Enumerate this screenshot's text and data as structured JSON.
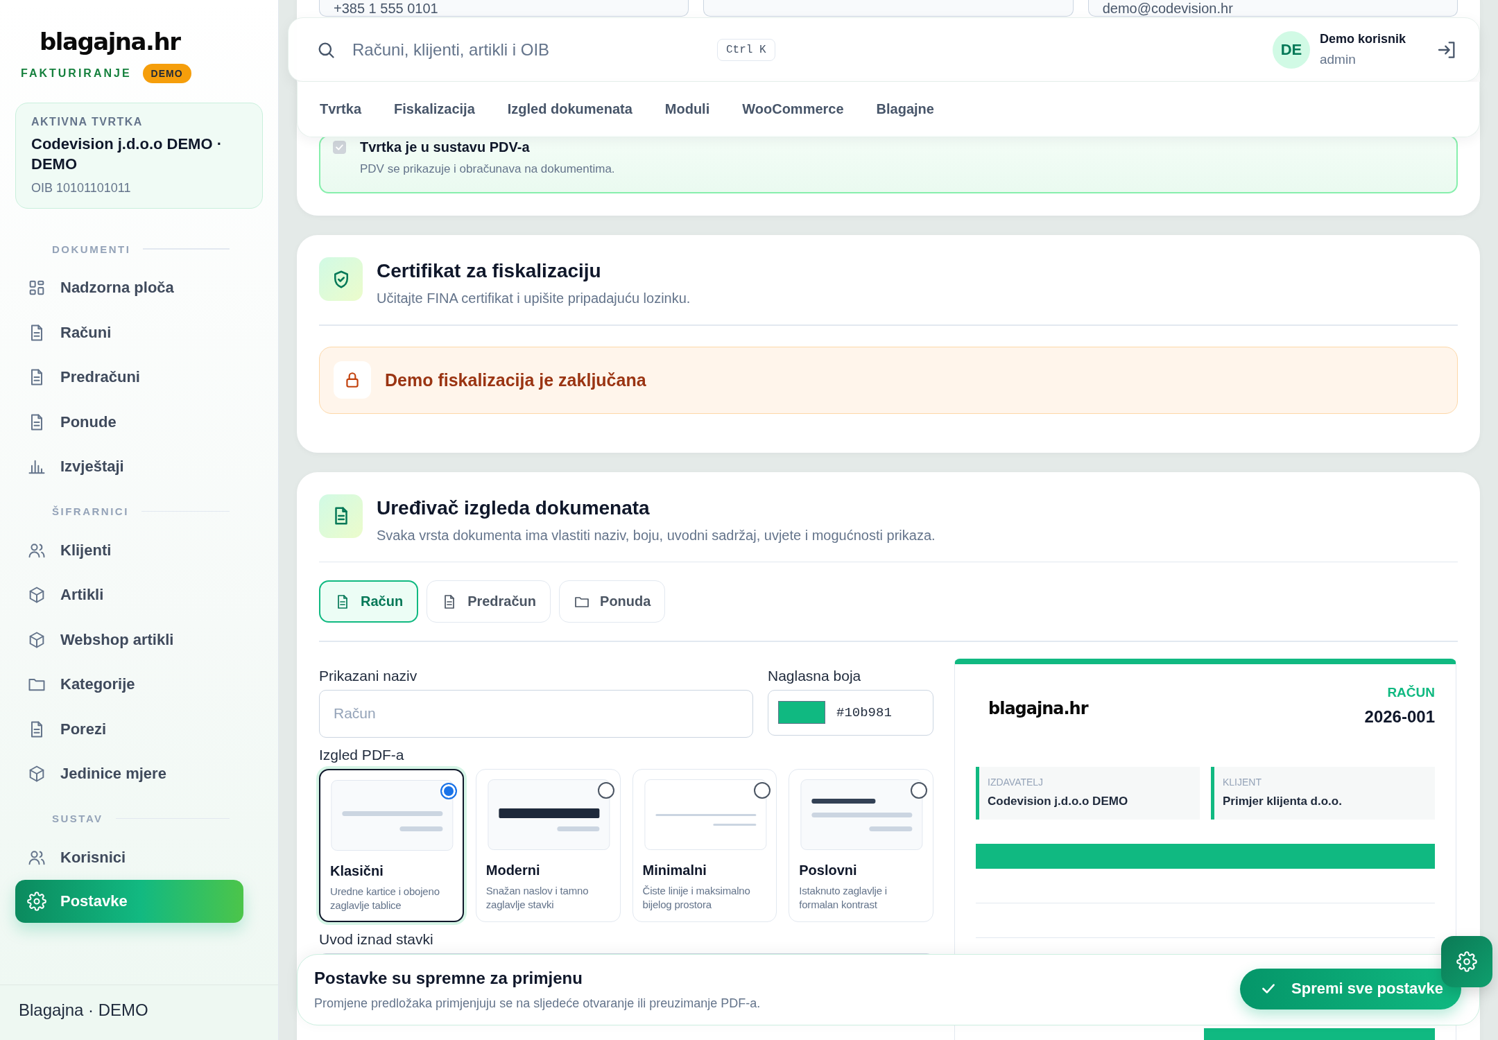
{
  "sidebar": {
    "logo": "blagajna.hr",
    "subtitle": "FAKTURIRANJE",
    "badge": "DEMO",
    "company": {
      "label": "AKTIVNA TVRTKA",
      "name": "Codevision j.d.o.o DEMO · DEMO",
      "oib": "OIB 10101101011"
    },
    "sections": [
      {
        "title": "DOKUMENTI",
        "items": [
          {
            "label": "Nadzorna ploča",
            "kind": "dashboard",
            "selected": false
          },
          {
            "label": "Računi",
            "kind": "document",
            "selected": false
          },
          {
            "label": "Predračuni",
            "kind": "document",
            "selected": false
          },
          {
            "label": "Ponude",
            "kind": "document",
            "selected": false
          },
          {
            "label": "Izvještaji",
            "kind": "report",
            "selected": false
          }
        ]
      },
      {
        "title": "ŠIFRARNICI",
        "items": [
          {
            "label": "Klijenti",
            "kind": "people",
            "selected": false
          },
          {
            "label": "Artikli",
            "kind": "product",
            "selected": false
          },
          {
            "label": "Webshop artikli",
            "kind": "product",
            "selected": false
          },
          {
            "label": "Kategorije",
            "kind": "folder",
            "selected": false
          },
          {
            "label": "Porezi",
            "kind": "document",
            "selected": false
          },
          {
            "label": "Jedinice mjere",
            "kind": "product",
            "selected": false
          }
        ]
      },
      {
        "title": "SUSTAV",
        "items": [
          {
            "label": "Korisnici",
            "kind": "people",
            "selected": false
          },
          {
            "label": "Postavke",
            "kind": "settings",
            "selected": true
          }
        ]
      }
    ],
    "footer": "Blagajna · DEMO"
  },
  "search": {
    "placeholder": "Računi, klijenti, artikli i OIB",
    "shortcut": "Ctrl K"
  },
  "user": {
    "initials": "DE",
    "name": "Demo korisnik",
    "role": "admin"
  },
  "settings_tabs": [
    {
      "label": "Tvrtka"
    },
    {
      "label": "Fiskalizacija"
    },
    {
      "label": "Izgled dokumenata"
    },
    {
      "label": "Moduli"
    },
    {
      "label": "WooCommerce"
    },
    {
      "label": "Blagajne"
    }
  ],
  "company_card": {
    "fields": [
      {
        "kind": "filled",
        "value": "+385 1 555 0101"
      },
      {
        "kind": "empty"
      },
      {
        "kind": "filled",
        "value": "demo@codevision.hr"
      }
    ],
    "vat": {
      "label": "Tvrtka je u sustavu PDV-a",
      "description": "PDV se prikazuje i obračunava na dokumentima.",
      "checked": true
    }
  },
  "certificate": {
    "title": "Certifikat za fiskalizaciju",
    "subtitle": "Učitajte FINA certifikat i upišite pripadajuću lozinku.",
    "alert": "Demo fiskalizacija je zaključana"
  },
  "editor": {
    "title": "Uređivač izgleda dokumenata",
    "subtitle": "Svaka vrsta dokumenta ima vlastiti naziv, boju, uvodni sadržaj, uvjete i mogućnosti prikaza.",
    "doc_tabs": [
      {
        "label": "Račun",
        "kind": "document",
        "selected": true
      },
      {
        "label": "Predračun",
        "kind": "document",
        "selected": false
      },
      {
        "label": "Ponuda",
        "kind": "folder",
        "selected": false
      }
    ],
    "name_field": {
      "label": "Prikazani naziv",
      "placeholder": "Račun"
    },
    "accent": {
      "label": "Naglasna boja",
      "value": "#10b981"
    },
    "templates_label": "Izgled PDF-a",
    "templates": [
      {
        "kind": "classic",
        "name": "Klasični",
        "description": "Uredne kartice i obojeno zaglavlje tablice",
        "selected": true
      },
      {
        "kind": "modern",
        "name": "Moderni",
        "description": "Snažan naslov i tamno zaglavlje stavki",
        "selected": false
      },
      {
        "kind": "minimal",
        "name": "Minimalni",
        "description": "Čiste linije i maksimalno bijelog prostora",
        "selected": false
      },
      {
        "kind": "business",
        "name": "Poslovni",
        "description": "Istaknuto zaglavlje i formalan kontrast",
        "selected": false
      }
    ],
    "intro_label": "Uvod iznad stavki",
    "preview": {
      "logo": "blagajna.hr",
      "doc_type": "RAČUN",
      "number": "2026-001",
      "parties": [
        {
          "label": "IZDAVATELJ",
          "name": "Codevision j.d.o.o DEMO"
        },
        {
          "label": "KLIJENT",
          "name": "Primjer klijenta d.o.o."
        }
      ]
    }
  },
  "footer_bar": {
    "title": "Postavke su spremne za primjenu",
    "subtitle": "Promjene predložaka primjenjuju se na sljedeće otvaranje ili preuzimanje PDF-a.",
    "button": "Spremi sve postavke"
  }
}
